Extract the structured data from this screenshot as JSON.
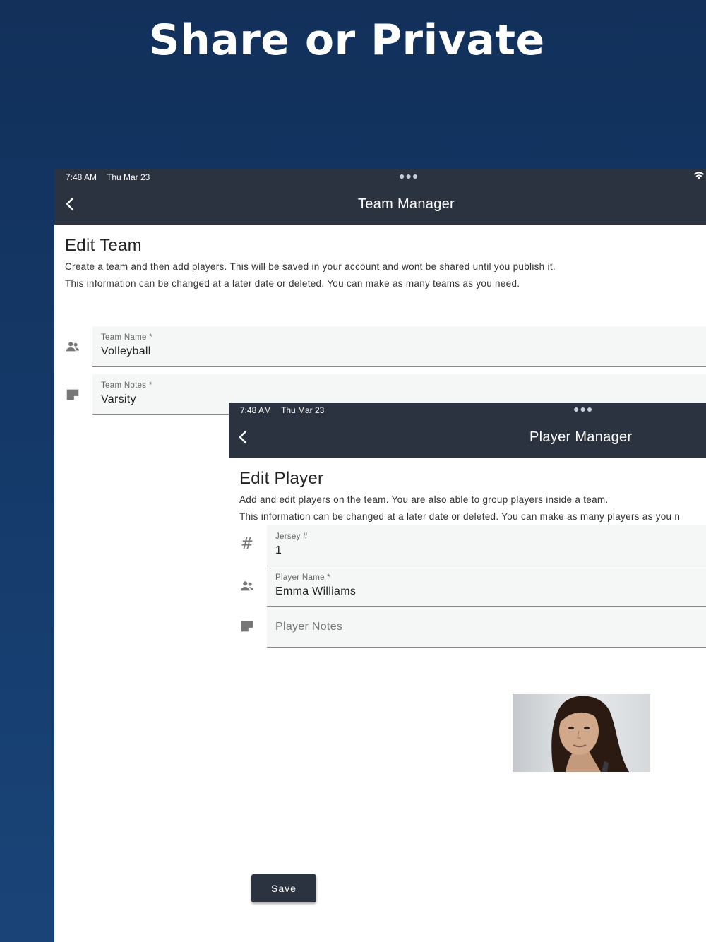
{
  "headline": "Share or Private",
  "team_screen": {
    "status": {
      "time": "7:48 AM",
      "date": "Thu Mar 23"
    },
    "nav_title": "Team Manager",
    "heading": "Edit Team",
    "desc1": "Create a team and then add players. This will be saved in your account and  wont be shared until you publish it.",
    "desc2": "This information can be changed at a later date or deleted.  You can make as many  teams as you need.",
    "fields": {
      "team_name": {
        "label": "Team Name *",
        "value": "Volleyball"
      },
      "team_notes": {
        "label": "Team Notes *",
        "value": "Varsity"
      }
    }
  },
  "player_screen": {
    "status": {
      "time": "7:48 AM",
      "date": "Thu Mar 23"
    },
    "nav_title": "Player Manager",
    "heading": "Edit Player",
    "desc1": "Add and edit players on the team. You are also able to group players inside a team.",
    "desc2": "This information can be changed at a later date or deleted. You can make as many  players as you n",
    "fields": {
      "jersey": {
        "label": "Jersey #",
        "value": "1"
      },
      "player_name": {
        "label": "Player Name *",
        "value": "Emma Williams"
      },
      "player_notes": {
        "placeholder": "Player Notes"
      }
    },
    "save_label": "Save"
  },
  "icons": [
    "back-chevron-icon",
    "people-icon",
    "note-icon",
    "hash-icon",
    "wifi-icon",
    "more-dots-icon"
  ],
  "colors": {
    "background": "#143a6a",
    "navbar": "#2b3240",
    "field_bg": "#f5f6f6"
  }
}
